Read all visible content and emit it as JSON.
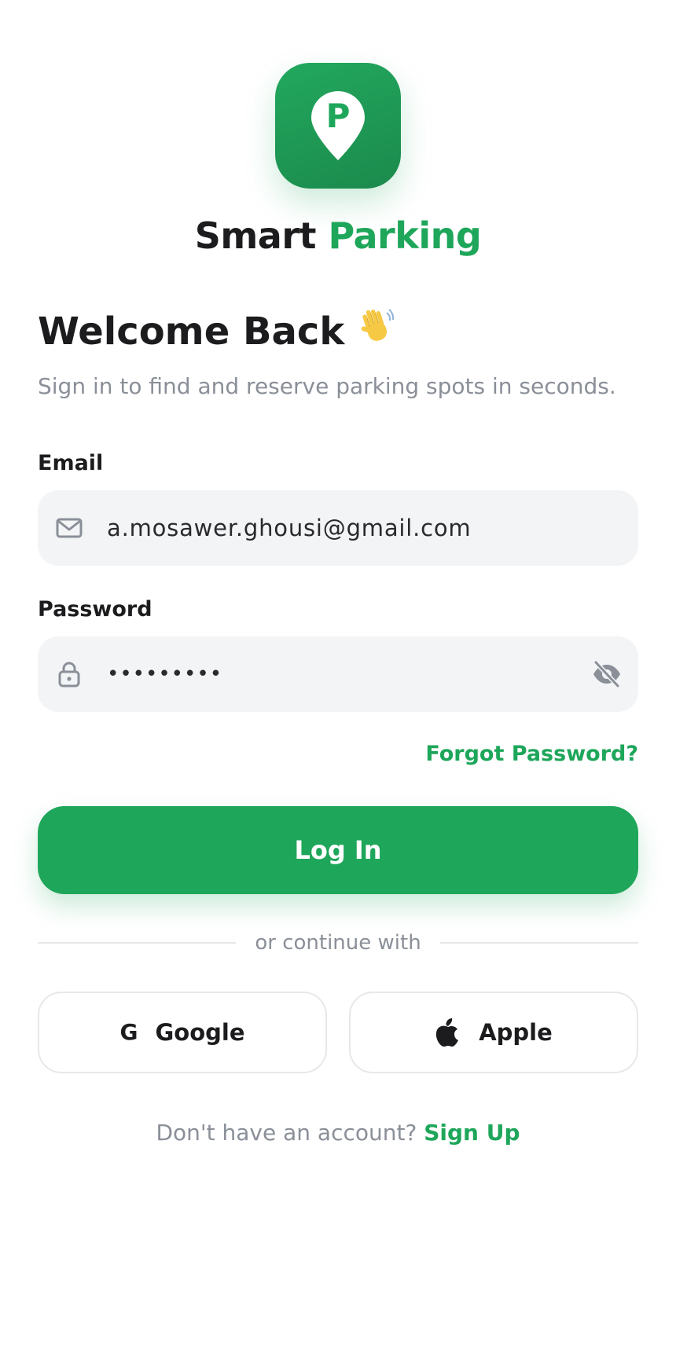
{
  "brand": {
    "name_primary": "Smart",
    "name_accent": "Parking",
    "logo_letter": "P",
    "accent_color": "#1ea65a"
  },
  "heading": {
    "title": "Welcome Back",
    "title_emoji": "👋",
    "subtitle": "Sign in to find and reserve parking spots in seconds."
  },
  "form": {
    "email": {
      "label": "Email",
      "value": "a.mosawer.ghousi@gmail.com",
      "icon": "mail-icon"
    },
    "password": {
      "label": "Password",
      "value": "•••••••••",
      "icon": "lock-icon",
      "toggle_icon": "eye-off-icon"
    },
    "forgot_label": "Forgot Password?",
    "submit_label": "Log In"
  },
  "divider": {
    "text": "or continue with"
  },
  "social": {
    "google_label": "Google",
    "google_glyph": "G",
    "apple_label": "Apple"
  },
  "footer": {
    "prompt": "Don't have an account?",
    "signup_label": "Sign Up"
  }
}
